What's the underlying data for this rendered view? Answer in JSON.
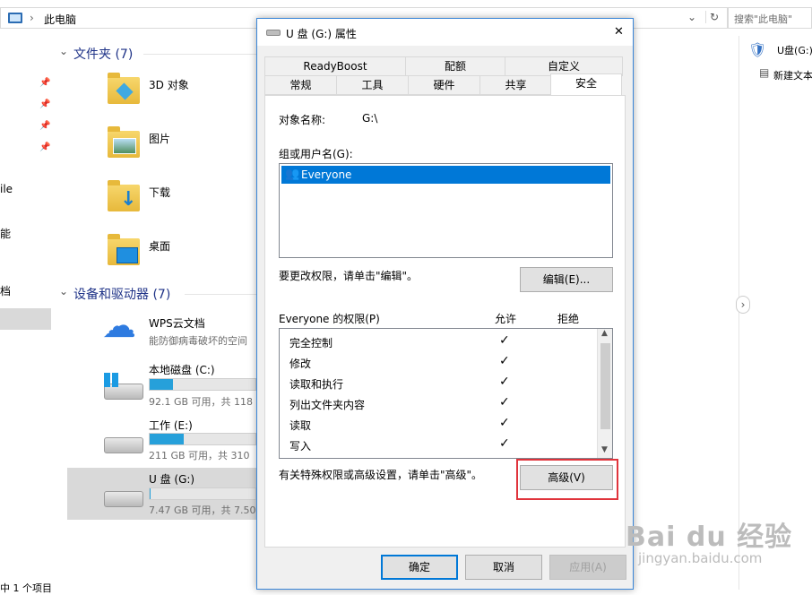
{
  "explorer": {
    "address": "此电脑",
    "search_placeholder": "搜索\"此电脑\"",
    "nav_partial": [
      "ile",
      "能",
      "档"
    ],
    "folders_group": "文件夹 (7)",
    "folders": [
      "3D 对象",
      "图片",
      "下载",
      "桌面"
    ],
    "devices_group": "设备和驱动器 (7)",
    "wps": {
      "name": "WPS云文档",
      "desc": "能防御病毒破坏的空间"
    },
    "drives": [
      {
        "name": "本地磁盘 (C:)",
        "space": "92.1 GB 可用，共 118",
        "fill": 0.22
      },
      {
        "name": "工作 (E:)",
        "space": "211 GB 可用，共 310",
        "fill": 0.32
      },
      {
        "name": "U 盘 (G:)",
        "space": "7.47 GB 可用，共 7.50",
        "fill": 0.01
      }
    ],
    "status": "中 1 个项目",
    "right_items": [
      "U盘(G:)",
      "新建文本"
    ]
  },
  "dialog": {
    "title": "U 盘 (G:) 属性",
    "close": "✕",
    "tabs_row1": [
      "ReadyBoost",
      "配额",
      "自定义"
    ],
    "tabs_row2": [
      "常规",
      "工具",
      "硬件",
      "共享",
      "安全"
    ],
    "object_label": "对象名称:",
    "object_value": "G:\\",
    "group_label": "组或用户名(G):",
    "users": [
      "Everyone"
    ],
    "change_text": "要更改权限，请单击\"编辑\"。",
    "edit_button": "编辑(E)...",
    "perm_label": "Everyone 的权限(P)",
    "allow_header": "允许",
    "deny_header": "拒绝",
    "permissions": [
      {
        "name": "完全控制",
        "allow": "✓",
        "deny": ""
      },
      {
        "name": "修改",
        "allow": "✓",
        "deny": ""
      },
      {
        "name": "读取和执行",
        "allow": "✓",
        "deny": ""
      },
      {
        "name": "列出文件夹内容",
        "allow": "✓",
        "deny": ""
      },
      {
        "name": "读取",
        "allow": "✓",
        "deny": ""
      },
      {
        "name": "写入",
        "allow": "✓",
        "deny": ""
      }
    ],
    "advanced_text": "有关特殊权限或高级设置，请单击\"高级\"。",
    "advanced_button": "高级(V)",
    "ok_button": "确定",
    "cancel_button": "取消",
    "apply_button": "应用(A)"
  },
  "watermark": {
    "brand": "Bai du 经验",
    "url": "jingyan.baidu.com"
  }
}
